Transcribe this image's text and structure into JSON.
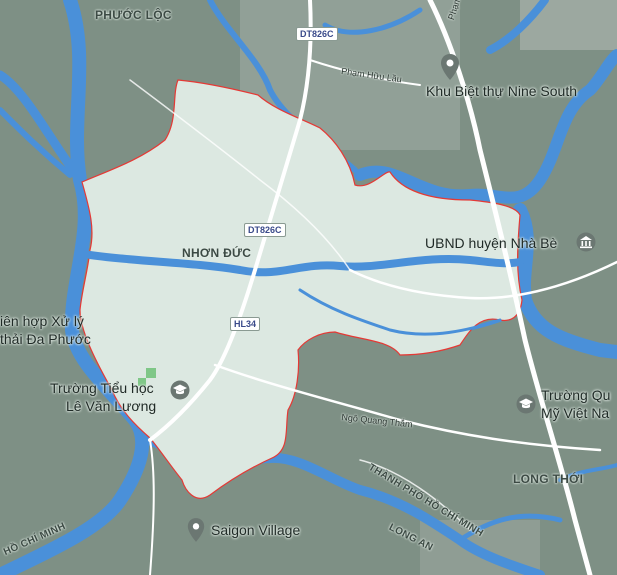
{
  "map": {
    "areas": {
      "phuoc_loc": "PHƯỚC LỘC",
      "nhon_duc": "NHƠN ĐỨC",
      "long_thoi": "LONG THỚI",
      "tp_hcm_lower": "THÀNH PHỐ HỒ CHÍ MINH",
      "tp_hcm_left": "HỒ CHÍ MINH",
      "long_an": "LONG AN"
    },
    "roads": {
      "dt826c_top": "DT826C",
      "dt826c_mid": "DT826C",
      "hl34": "HL34",
      "pham_huu_lau": "Phạm Hữu Lầu",
      "pham_huu_top": "Phạm Hữu",
      "ngo_quang_tham": "Ngô Quang Thắm"
    },
    "pois": {
      "nine_south": "Khu Biệt thự Nine South",
      "ubnd": "UBND huyện Nhà Bè",
      "xu_ly_line1": "iên hợp Xử lý",
      "xu_ly_line2": "thải Đa Phước",
      "truong_tieu_hoc_line1": "Trường Tiểu học",
      "truong_tieu_hoc_line2": "Lê Văn Lương",
      "truong_quoc_te_line1": "Trường Qu",
      "truong_quoc_te_line2": "Mỹ Việt Na",
      "saigon_village": "Saigon Village"
    },
    "icons": {
      "pin": "map-pin-icon",
      "school": "school-icon",
      "government": "government-icon"
    },
    "colors": {
      "water": "#4a90d9",
      "land": "#7d8f84",
      "selected_area": "#dbe7e0",
      "boundary": "#e53935",
      "road": "#ffffff"
    }
  }
}
